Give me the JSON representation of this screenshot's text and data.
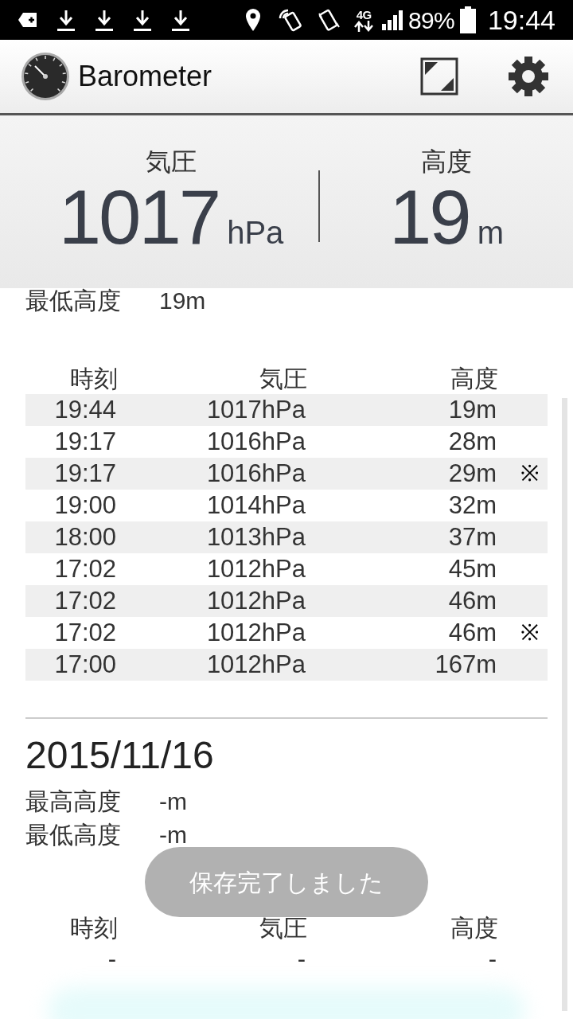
{
  "status_bar": {
    "battery": "89%",
    "network": "4G",
    "time": "19:44"
  },
  "app_bar": {
    "title": "Barometer"
  },
  "current": {
    "pressure": {
      "label": "気圧",
      "value": "1017",
      "unit": "hPa"
    },
    "altitude": {
      "label": "高度",
      "value": "19",
      "unit": "m"
    }
  },
  "today": {
    "min_altitude": {
      "label": "最低高度",
      "value": "19m"
    },
    "table": {
      "columns": [
        "時刻",
        "気圧",
        "高度"
      ],
      "rows": [
        {
          "time": "19:44",
          "pressure": "1017hPa",
          "altitude": "19m"
        },
        {
          "time": "19:17",
          "pressure": "1016hPa",
          "altitude": "28m"
        },
        {
          "time": "19:17",
          "pressure": "1016hPa",
          "altitude": "29m",
          "note": "※"
        },
        {
          "time": "19:00",
          "pressure": "1014hPa",
          "altitude": "32m"
        },
        {
          "time": "18:00",
          "pressure": "1013hPa",
          "altitude": "37m"
        },
        {
          "time": "17:02",
          "pressure": "1012hPa",
          "altitude": "45m"
        },
        {
          "time": "17:02",
          "pressure": "1012hPa",
          "altitude": "46m"
        },
        {
          "time": "17:02",
          "pressure": "1012hPa",
          "altitude": "46m",
          "note": "※"
        },
        {
          "time": "17:00",
          "pressure": "1012hPa",
          "altitude": "167m"
        }
      ]
    }
  },
  "days": [
    {
      "date": "2015/11/16",
      "max_altitude": {
        "label": "最高高度",
        "value": "-m"
      },
      "min_altitude": {
        "label": "最低高度",
        "value": "-m"
      },
      "table": {
        "columns": [
          "時刻",
          "気圧",
          "高度"
        ],
        "rows": [
          {
            "time": "-",
            "pressure": "-",
            "altitude": "-"
          }
        ]
      }
    }
  ],
  "toast": {
    "text": "保存完了しました"
  }
}
